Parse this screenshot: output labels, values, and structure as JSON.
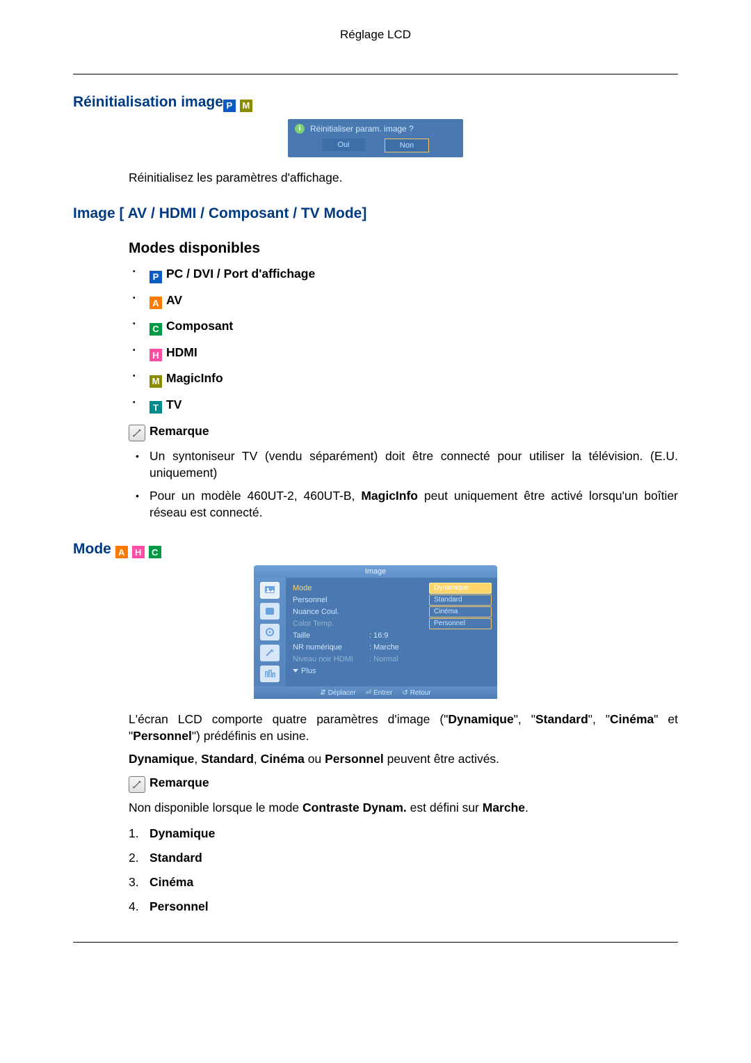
{
  "header": {
    "title": "Réglage LCD"
  },
  "sections": {
    "reset": {
      "heading": "Réinitialisation image",
      "badges": [
        "P",
        "M"
      ],
      "dialog": {
        "question": "Réinitialiser param. image ?",
        "yes": "Oui",
        "no": "Non"
      },
      "text": "Réinitialisez les paramètres d'affichage."
    },
    "image_modes": {
      "heading": "Image [ AV / HDMI / Composant / TV Mode]",
      "subheading": "Modes disponibles",
      "modes": [
        {
          "badge": "P",
          "label": "PC / DVI / Port d'affichage"
        },
        {
          "badge": "A",
          "label": "AV"
        },
        {
          "badge": "C",
          "label": "Composant"
        },
        {
          "badge": "H",
          "label": "HDMI"
        },
        {
          "badge": "M",
          "label": "MagicInfo"
        },
        {
          "badge": "T",
          "label": "TV"
        }
      ],
      "remarque_label": "Remarque",
      "notes": [
        "Un syntoniseur TV (vendu séparément) doit être connecté pour utiliser la télévision. (E.U. uniquement)",
        "Pour un modèle 460UT-2, 460UT-B, MagicInfo peut uniquement être activé lorsqu'un boîtier réseau est connecté."
      ],
      "note1_pre": "Pour un modèle 460UT-2, 460UT-B, ",
      "note1_bold": "MagicInfo",
      "note1_post": " peut uniquement être activé lorsqu'un boîtier réseau est connecté."
    },
    "mode": {
      "heading": "Mode ",
      "badges": [
        "A",
        "H",
        "C"
      ],
      "osd": {
        "title": "Image",
        "items": {
          "mode": "Mode",
          "personnel": "Personnel",
          "nuance": "Nuance Coul.",
          "colortemp": "Color Temp.",
          "taille": "Taille",
          "nr": "NR numérique",
          "niveau": "Niveau noir HDMI",
          "plus": "Plus"
        },
        "values": {
          "taille": "16:9",
          "nr": "Marche",
          "niveau": "Normal"
        },
        "options": {
          "dynamique": "Dynamique",
          "standard": "Standard",
          "cinema": "Cinéma",
          "personnel": "Personnel"
        },
        "foot": {
          "move": "Déplacer",
          "enter": "Entrer",
          "ret": "Retour"
        }
      },
      "desc_pre": "L'écran LCD comporte quatre paramètres d'image (\"",
      "desc_b1": "Dynamique",
      "desc_mid1": "\", \"",
      "desc_b2": "Standard",
      "desc_mid2": "\", \"",
      "desc_b3": "Cinéma",
      "desc_mid3": "\" et \"",
      "desc_b4": "Personnel",
      "desc_post": "\") prédéfinis en usine.",
      "line2_b1": "Dynamique",
      "line2_s1": ", ",
      "line2_b2": "Standard",
      "line2_s2": ", ",
      "line2_b3": "Cinéma",
      "line2_s3": " ou ",
      "line2_b4": "Personnel",
      "line2_post": " peuvent être activés.",
      "remarque_label": "Remarque",
      "remarque_pre": "Non disponible lorsque le mode ",
      "remarque_bold": "Contraste Dynam.",
      "remarque_mid": " est défini sur ",
      "remarque_bold2": "Marche",
      "remarque_post": ".",
      "list": [
        "Dynamique",
        "Standard",
        "Cinéma",
        "Personnel"
      ]
    }
  }
}
